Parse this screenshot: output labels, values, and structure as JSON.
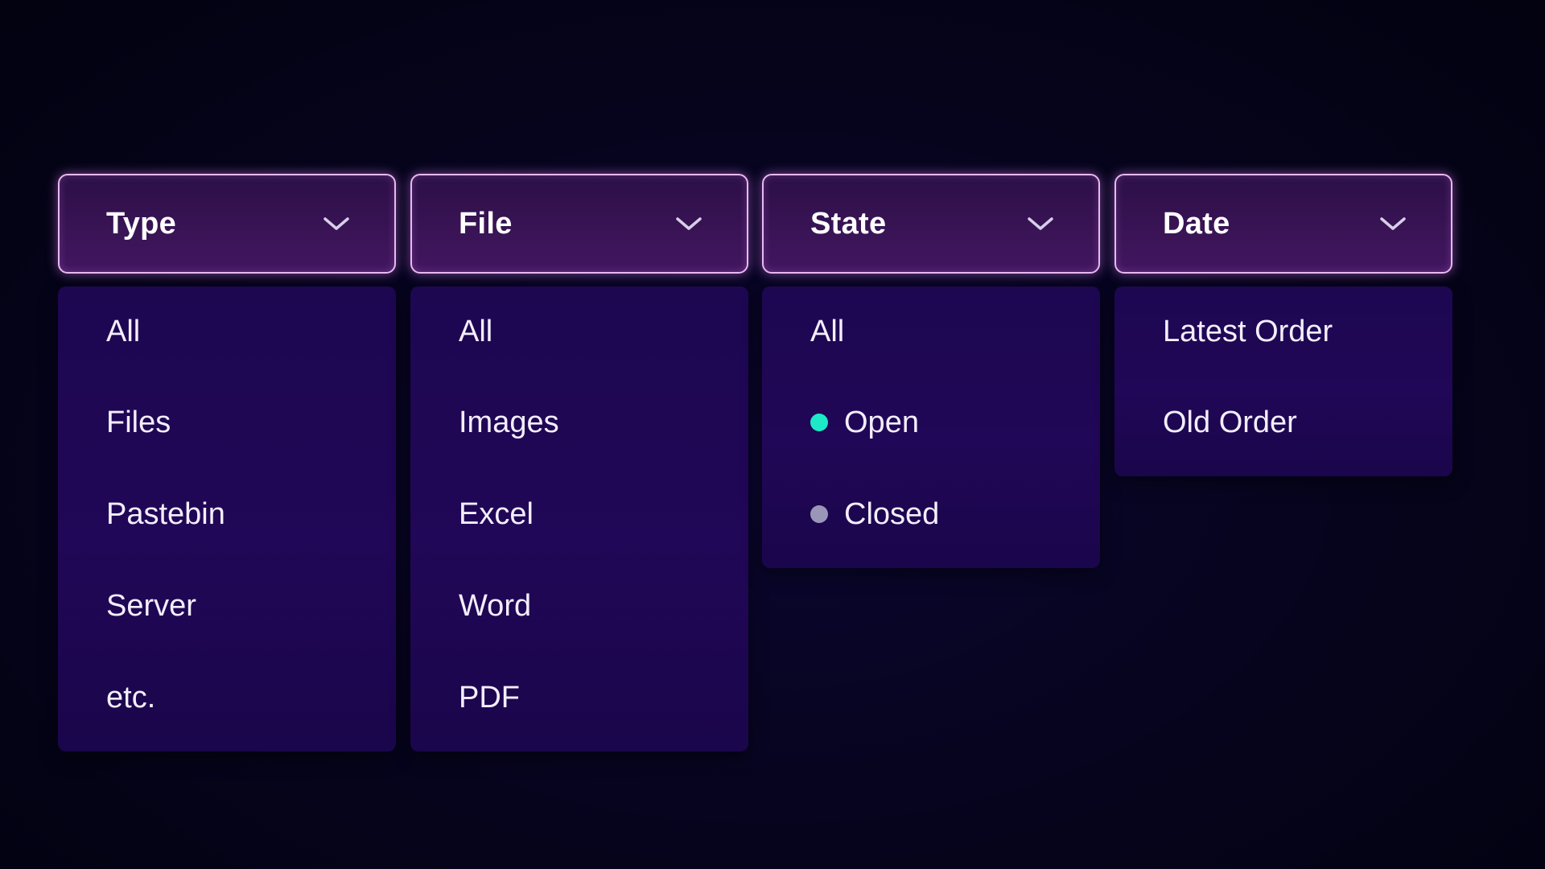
{
  "dropdowns": {
    "type": {
      "label": "Type",
      "icon": "chevron-down-icon",
      "items": [
        "All",
        "Files",
        "Pastebin",
        "Server",
        "etc."
      ]
    },
    "file": {
      "label": "File",
      "icon": "chevron-down-icon",
      "items": [
        "All",
        "Images",
        "Excel",
        "Word",
        "PDF"
      ]
    },
    "state": {
      "label": "State",
      "icon": "chevron-down-icon",
      "items": [
        {
          "label": "All"
        },
        {
          "label": "Open",
          "dot_color": "#1de9c8"
        },
        {
          "label": "Closed",
          "dot_color": "#9a96b8"
        }
      ]
    },
    "date": {
      "label": "Date",
      "icon": "chevron-down-icon",
      "items": [
        "Latest Order",
        "Old Order"
      ]
    }
  },
  "colors": {
    "header_border": "#e9b9f0",
    "menu_background": "#1f0754",
    "page_background": "#06041c",
    "open_status": "#1de9c8",
    "closed_status": "#9a96b8"
  }
}
